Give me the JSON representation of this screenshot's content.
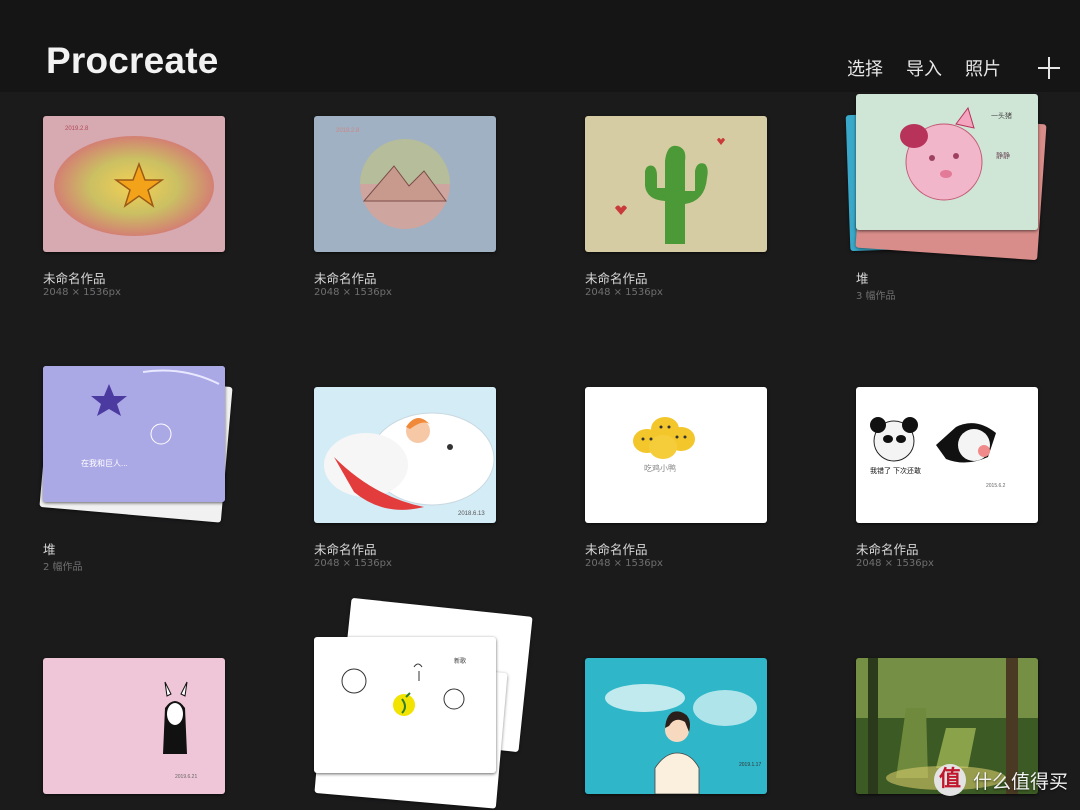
{
  "header": {
    "title": "Procreate",
    "actions": {
      "select": "选择",
      "import": "导入",
      "photos": "照片"
    }
  },
  "gallery": [
    {
      "title": "未命名作品",
      "subtitle": "2048 × 1536px"
    },
    {
      "title": "未命名作品",
      "subtitle": "2048 × 1536px"
    },
    {
      "title": "未命名作品",
      "subtitle": "2048 × 1536px"
    },
    {
      "title": "堆",
      "subtitle": "3 幅作品"
    },
    {
      "title": "堆",
      "subtitle": "2 幅作品"
    },
    {
      "title": "未命名作品",
      "subtitle": "2048 × 1536px"
    },
    {
      "title": "未命名作品",
      "subtitle": "2048 × 1536px"
    },
    {
      "title": "未命名作品",
      "subtitle": "2048 × 1536px"
    },
    {
      "title": "",
      "subtitle": ""
    },
    {
      "title": "",
      "subtitle": ""
    },
    {
      "title": "",
      "subtitle": ""
    },
    {
      "title": "",
      "subtitle": ""
    }
  ],
  "artwork_text": {
    "panda_caption": "我错了 下次还敢",
    "chick_caption": "吃鸡小鸭"
  },
  "watermark": {
    "logo": "值",
    "text": "什么值得买"
  }
}
